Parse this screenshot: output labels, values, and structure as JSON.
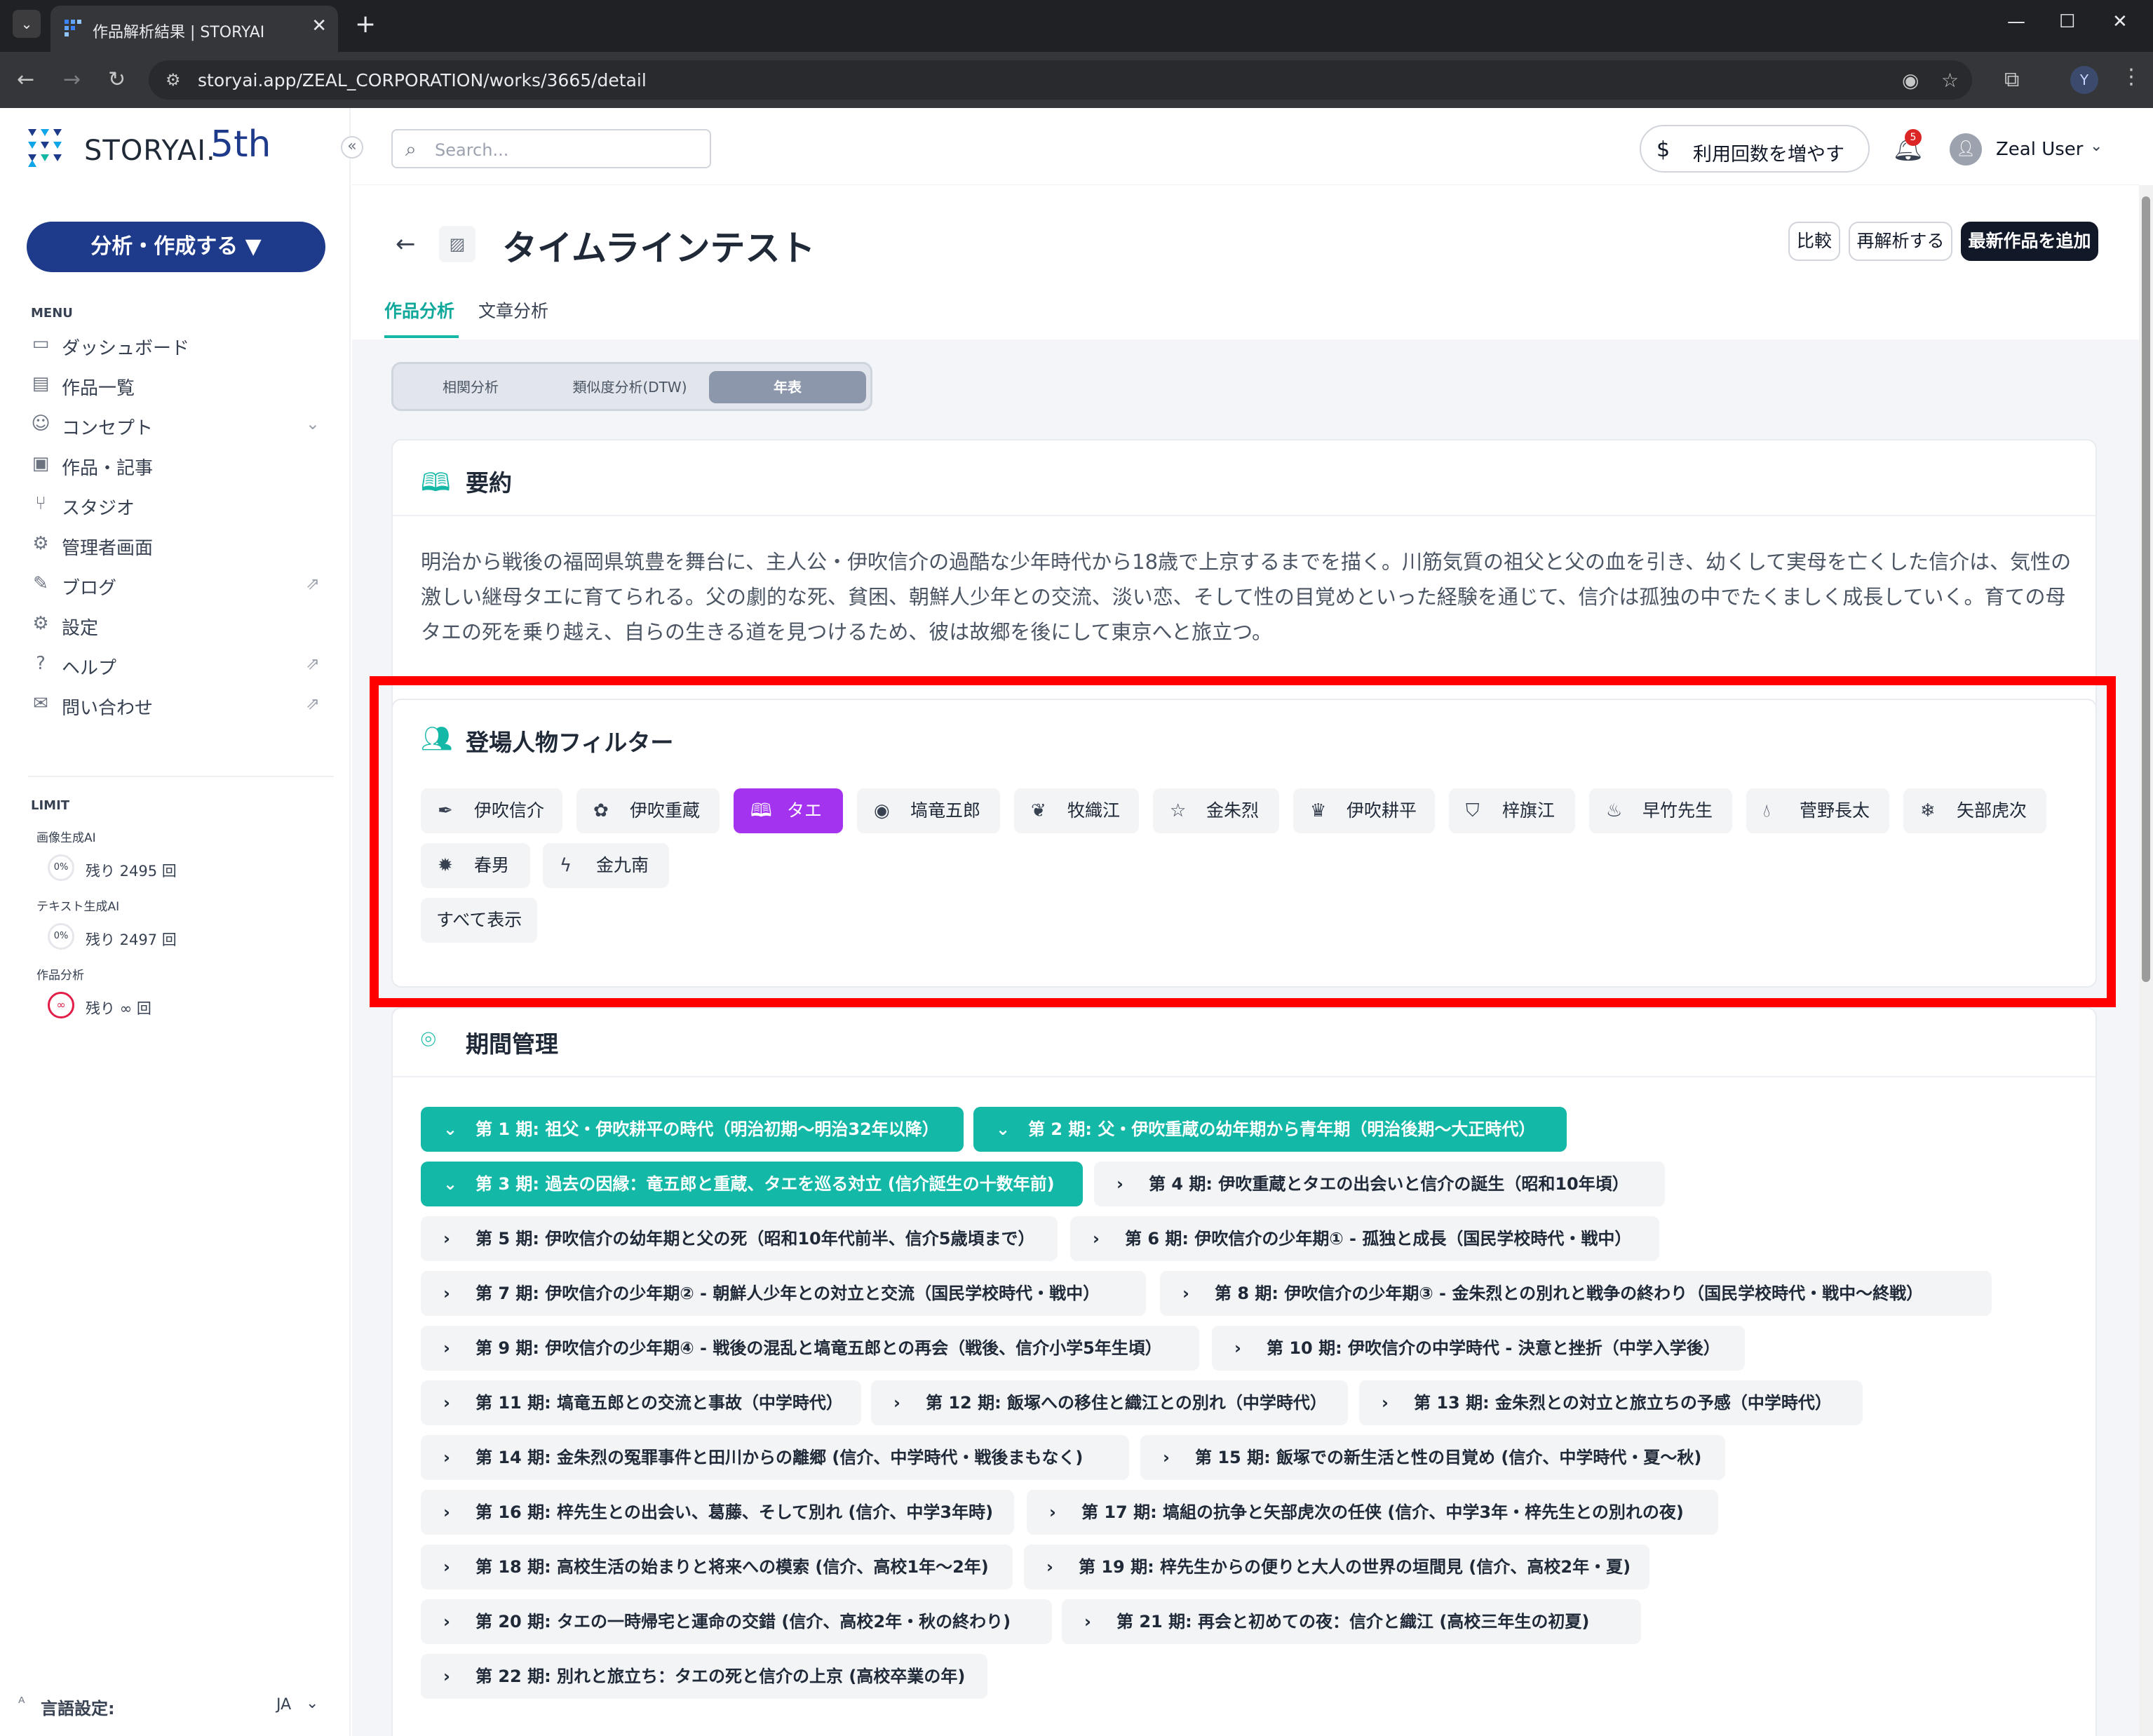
{
  "browser": {
    "tab_title": "作品解析結果 | STORYAI",
    "url": "storyai.app/ZEAL_CORPORATION/works/3665/detail",
    "profile_initial": "Y"
  },
  "sidebar": {
    "logo_text": "STORYAI.",
    "logo_badge": "5th",
    "cta_label": "分析・作成する ▼",
    "menu_label": "MENU",
    "items": [
      {
        "label": "ダッシュボード",
        "icon": "dashboard-icon"
      },
      {
        "label": "作品一覧",
        "icon": "document-icon"
      },
      {
        "label": "コンセプト",
        "icon": "smile-icon"
      },
      {
        "label": "作品・記事",
        "icon": "article-icon"
      },
      {
        "label": "スタジオ",
        "icon": "branch-icon"
      },
      {
        "label": "管理者画面",
        "icon": "gear-icon"
      },
      {
        "label": "ブログ",
        "icon": "edit-icon"
      },
      {
        "label": "設定",
        "icon": "gear-icon"
      },
      {
        "label": "ヘルプ",
        "icon": "help-icon"
      },
      {
        "label": "問い合わせ",
        "icon": "mail-icon"
      }
    ],
    "limit_label": "LIMIT",
    "limits": [
      {
        "title": "画像生成AI",
        "percent": "0%",
        "remaining": "残り 2495 回"
      },
      {
        "title": "テキスト生成AI",
        "percent": "0%",
        "remaining": "残り 2497 回"
      },
      {
        "title": "作品分析",
        "percent": "∞",
        "remaining": "残り ∞ 回"
      }
    ],
    "language_label": "言語設定:",
    "language_value": "JA"
  },
  "topbar": {
    "search_placeholder": "Search...",
    "usage_button": "利用回数を増やす",
    "notification_count": "5",
    "user_name": "Zeal User"
  },
  "page": {
    "title": "タイムラインテスト",
    "buttons": {
      "compare": "比較",
      "reanalyze": "再解析する",
      "add_latest": "最新作品を追加"
    },
    "tabs": [
      "作品分析",
      "文章分析"
    ],
    "segments": [
      "相関分析",
      "類似度分析(DTW)",
      "年表"
    ],
    "active_segment": "年表"
  },
  "summary": {
    "title": "要約",
    "text": "明治から戦後の福岡県筑豊を舞台に、主人公・伊吹信介の過酷な少年時代から18歳で上京するまでを描く。川筋気質の祖父と父の血を引き、幼くして実母を亡くした信介は、気性の激しい継母タエに育てられる。父の劇的な死、貧困、朝鮮人少年との交流、淡い恋、そして性の目覚めといった経験を通じて、信介は孤独の中でたくましく成長していく。育ての母タエの死を乗り越え、自らの生きる道を見つけるため、彼は故郷を後にして東京へと旅立つ。"
  },
  "character_filter": {
    "title": "登場人物フィルター",
    "characters": [
      {
        "name": "伊吹信介",
        "icon": "feather-icon",
        "active": false
      },
      {
        "name": "伊吹重蔵",
        "icon": "flower-icon",
        "active": false
      },
      {
        "name": "タエ",
        "icon": "book-icon",
        "active": true
      },
      {
        "name": "塙竜五郎",
        "icon": "user-circle-icon",
        "active": false
      },
      {
        "name": "牧織江",
        "icon": "leaf-icon",
        "active": false
      },
      {
        "name": "金朱烈",
        "icon": "star-icon",
        "active": false
      },
      {
        "name": "伊吹耕平",
        "icon": "crown-icon",
        "active": false
      },
      {
        "name": "梓旗江",
        "icon": "shield-icon",
        "active": false
      },
      {
        "name": "早竹先生",
        "icon": "flame-icon",
        "active": false
      },
      {
        "name": "菅野長太",
        "icon": "drop-icon",
        "active": false
      },
      {
        "name": "矢部虎次",
        "icon": "snowflake-icon",
        "active": false
      },
      {
        "name": "春男",
        "icon": "bug-icon",
        "active": false
      },
      {
        "name": "金九南",
        "icon": "bolt-icon",
        "active": false
      }
    ],
    "show_all": "すべて表示"
  },
  "periods": {
    "title": "期間管理",
    "items": [
      {
        "label": "第 1 期: 祖父・伊吹耕平の時代（明治初期〜明治32年以降）",
        "open": true
      },
      {
        "label": "第 2 期: 父・伊吹重蔵の幼年期から青年期（明治後期〜大正時代）",
        "open": true
      },
      {
        "label": "第 3 期: 過去の因縁：竜五郎と重蔵、タエを巡る対立 (信介誕生の十数年前)",
        "open": true
      },
      {
        "label": "第 4 期: 伊吹重蔵とタエの出会いと信介の誕生（昭和10年頃）",
        "open": false
      },
      {
        "label": "第 5 期: 伊吹信介の幼年期と父の死（昭和10年代前半、信介5歳頃まで）",
        "open": false
      },
      {
        "label": "第 6 期: 伊吹信介の少年期① - 孤独と成長（国民学校時代・戦中）",
        "open": false
      },
      {
        "label": "第 7 期: 伊吹信介の少年期② - 朝鮮人少年との対立と交流（国民学校時代・戦中）",
        "open": false
      },
      {
        "label": "第 8 期: 伊吹信介の少年期③ - 金朱烈との別れと戦争の終わり（国民学校時代・戦中〜終戦）",
        "open": false
      },
      {
        "label": "第 9 期: 伊吹信介の少年期④ - 戦後の混乱と塙竜五郎との再会（戦後、信介小学5年生頃）",
        "open": false
      },
      {
        "label": "第 10 期: 伊吹信介の中学時代 - 決意と挫折（中学入学後）",
        "open": false
      },
      {
        "label": "第 11 期: 塙竜五郎との交流と事故（中学時代）",
        "open": false
      },
      {
        "label": "第 12 期: 飯塚への移住と織江との別れ（中学時代）",
        "open": false
      },
      {
        "label": "第 13 期: 金朱烈との対立と旅立ちの予感（中学時代）",
        "open": false
      },
      {
        "label": "第 14 期: 金朱烈の冤罪事件と田川からの離郷 (信介、中学時代・戦後まもなく)",
        "open": false
      },
      {
        "label": "第 15 期: 飯塚での新生活と性の目覚め (信介、中学時代・夏〜秋)",
        "open": false
      },
      {
        "label": "第 16 期: 梓先生との出会い、葛藤、そして別れ (信介、中学3年時)",
        "open": false
      },
      {
        "label": "第 17 期: 塙組の抗争と矢部虎次の任侠 (信介、中学3年・梓先生との別れの夜)",
        "open": false
      },
      {
        "label": "第 18 期: 高校生活の始まりと将来への模索 (信介、高校1年〜2年)",
        "open": false
      },
      {
        "label": "第 19 期: 梓先生からの便りと大人の世界の垣間見 (信介、高校2年・夏)",
        "open": false
      },
      {
        "label": "第 20 期: タエの一時帰宅と運命の交錯 (信介、高校2年・秋の終わり)",
        "open": false
      },
      {
        "label": "第 21 期: 再会と初めての夜：信介と織江 (高校三年生の初夏)",
        "open": false
      },
      {
        "label": "第 22 期: 別れと旅立ち：タエの死と信介の上京 (高校卒業の年)",
        "open": false
      }
    ]
  },
  "colors": {
    "accent_teal": "#14b8a6",
    "brand_navy": "#1e3a8a",
    "active_chip_purple": "#a433f0",
    "highlight_red": "#ff0000"
  }
}
